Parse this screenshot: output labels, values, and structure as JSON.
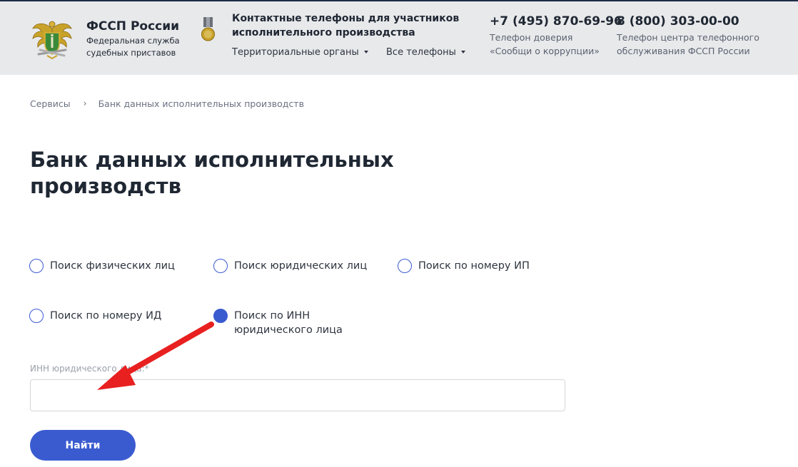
{
  "header": {
    "org_name": "ФССП России",
    "org_subtitle": "Федеральная служба судебных приставов",
    "contacts_title": "Контактные телефоны для участников исполнительного производства",
    "nav": {
      "territorial": "Территориальные органы",
      "all_phones": "Все телефоны"
    },
    "hotline": {
      "number": "+7 (495) 870-69-96",
      "note": "Телефон доверия «Сообщи о коррупции»"
    },
    "call_center": {
      "number": "8 (800) 303-00-00",
      "note": "Телефон центра телефонного обслуживания ФССП России"
    }
  },
  "breadcrumb": {
    "root": "Сервисы",
    "separator": "›",
    "current": "Банк данных исполнительных производств"
  },
  "page": {
    "title": "Банк данных исполнительных производств"
  },
  "search_options": [
    {
      "label": "Поиск физических лиц",
      "checked": false
    },
    {
      "label": "Поиск юридических лиц",
      "checked": false
    },
    {
      "label": "Поиск по номеру ИП",
      "checked": false
    },
    {
      "label": "Поиск по номеру ИД",
      "checked": false
    },
    {
      "label": "Поиск по ИНН юридического лица",
      "checked": true
    }
  ],
  "form": {
    "inn_label": "ИНН юридического лица:*",
    "inn_value": "",
    "submit_label": "Найти"
  },
  "colors": {
    "accent": "#3a5bd0",
    "header_bg": "#e8e9eb",
    "annotation_arrow": "#e82020"
  },
  "icons": {
    "logo": "fssp-emblem-icon",
    "medal": "medal-icon",
    "annotation": "red-arrow-annotation"
  }
}
